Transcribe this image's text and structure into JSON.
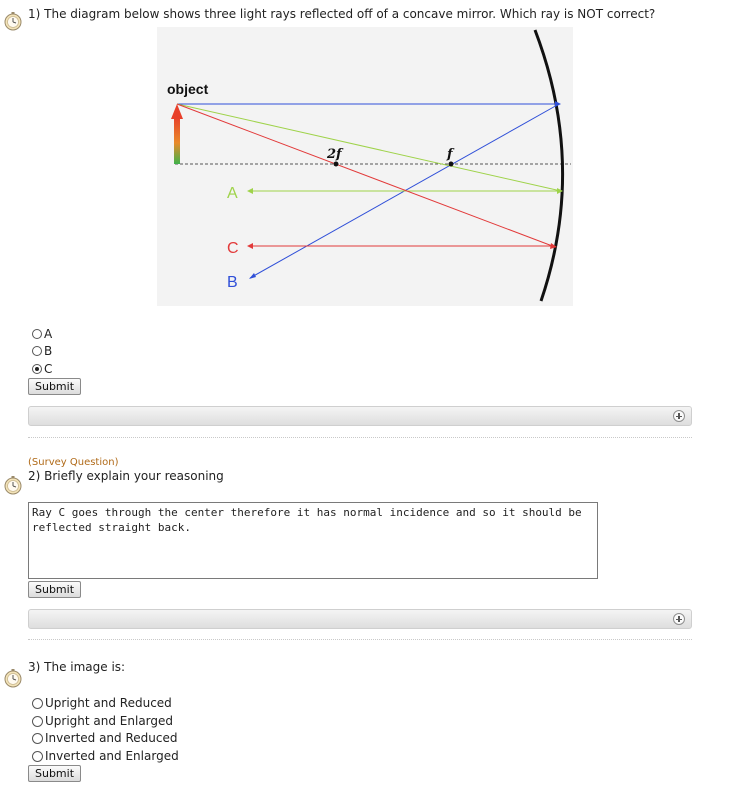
{
  "questions": [
    {
      "number_title": "1) The diagram below shows three light rays reflected off of a concave mirror. Which ray is NOT correct?",
      "options": [
        "A",
        "B",
        "C"
      ],
      "selected": "C",
      "submit_label": "Submit"
    },
    {
      "survey_tag": "(Survey Question)",
      "number_title": "2) Briefly explain your reasoning",
      "answer": "Ray C goes through the center therefore it has normal incidence and so it should be reflected straight back.",
      "submit_label": "Submit"
    },
    {
      "number_title": "3) The image is:",
      "options": [
        "Upright and Reduced",
        "Upright and Enlarged",
        "Inverted and Reduced",
        "Inverted and Enlarged"
      ],
      "submit_label": "Submit"
    }
  ],
  "diagram": {
    "object_label": "object",
    "two_f_label": "2f",
    "f_label": "f",
    "ray_labels": [
      "A",
      "C",
      "B"
    ],
    "colors": {
      "ray_a": "#9fd34a",
      "ray_b": "#2f4fd8",
      "ray_c": "#e23a3a",
      "mirror": "#111111",
      "background": "#f3f3f3"
    }
  },
  "icons": {
    "question_icon": "stopwatch-icon",
    "expand_icon": "plus-circle-icon"
  }
}
